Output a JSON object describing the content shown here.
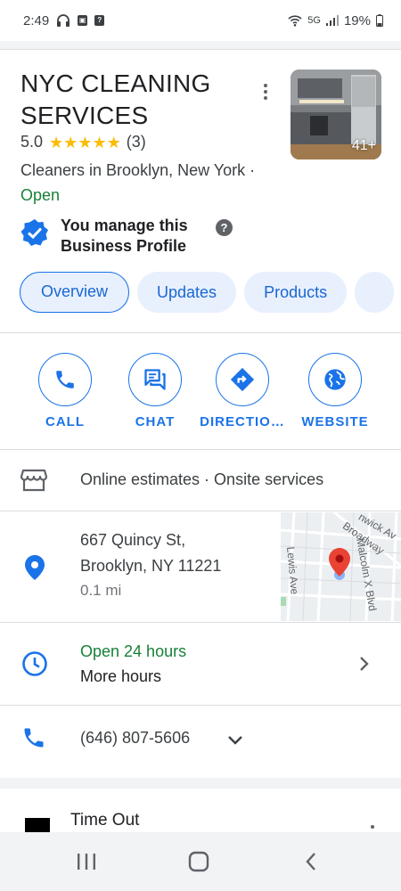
{
  "status_bar": {
    "time": "2:49",
    "network": "5G",
    "battery": "19%",
    "icons": [
      "headphones-icon",
      "notification-icon",
      "unknown-app-icon",
      "wifi-icon",
      "signal-icon",
      "battery-icon"
    ]
  },
  "business": {
    "name": "NYC CLEANING SERVICES",
    "rating": "5.0",
    "stars": 5,
    "review_count": "(3)",
    "category": "Cleaners in Brooklyn, New York",
    "separator": " · ",
    "status": "Open",
    "photo_count": "41+",
    "manage_text": "You manage this Business Profile",
    "help_glyph": "?"
  },
  "tabs": [
    {
      "label": "Overview",
      "active": true
    },
    {
      "label": "Updates",
      "active": false
    },
    {
      "label": "Products",
      "active": false
    }
  ],
  "actions": [
    {
      "label": "CALL",
      "icon": "phone-icon"
    },
    {
      "label": "CHAT",
      "icon": "chat-icon"
    },
    {
      "label": "DIRECTIO…",
      "icon": "directions-icon"
    },
    {
      "label": "WEBSITE",
      "icon": "globe-icon"
    }
  ],
  "services": {
    "text": "Online estimates · Onsite services",
    "icon": "storefront-icon"
  },
  "address": {
    "line1": "667 Quincy St,",
    "line2": "Brooklyn, NY 11221",
    "distance": "0.1 mi",
    "icon": "location-pin-icon"
  },
  "map": {
    "streets": [
      "Lewis Ave",
      "Malcolm X Blvd",
      "Broadway",
      "nwick Av"
    ]
  },
  "hours": {
    "status": "Open 24 hours",
    "more": "More hours",
    "icon": "clock-icon"
  },
  "phone": {
    "number": "(646) 807-5606",
    "icon": "phone-icon"
  },
  "related": {
    "title": "Time Out"
  },
  "colors": {
    "accent": "#1a73e8",
    "tab_bg": "#e8f0fe",
    "open_green": "#188038",
    "star": "#fbbc04",
    "pin_red": "#ea4335"
  }
}
